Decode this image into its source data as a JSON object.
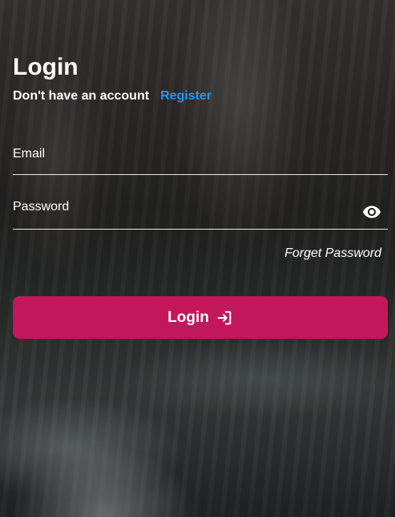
{
  "page": {
    "title": "Login",
    "no_account_text": "Don't have an account",
    "register_link": "Register"
  },
  "form": {
    "email_placeholder": "Email",
    "email_value": "",
    "password_placeholder": "Password",
    "password_value": "",
    "password_toggle_icon": "eye-icon",
    "forgot_password_link": "Forget Password",
    "submit_label": "Login",
    "submit_icon": "login-arrow-icon"
  },
  "colors": {
    "accent_button": "#c2185b",
    "link": "#2196f3",
    "text": "#ffffff"
  }
}
